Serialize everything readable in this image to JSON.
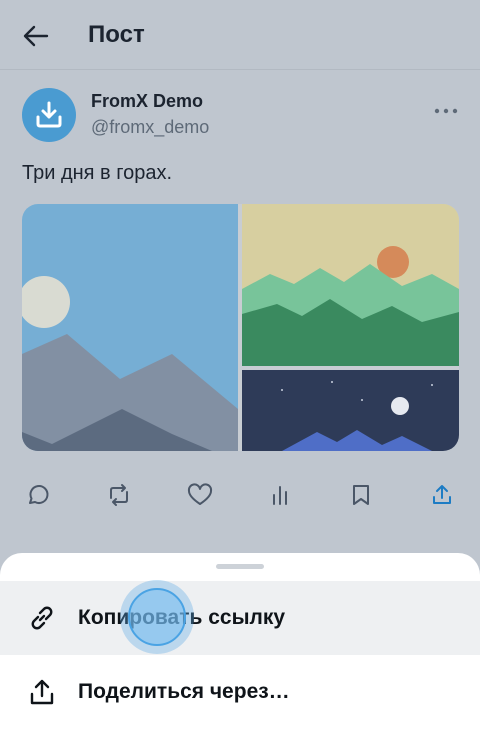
{
  "header": {
    "title": "Пост",
    "back_icon": "arrow-left-icon"
  },
  "post": {
    "author_name": "FromX Demo",
    "author_handle": "@fromx_demo",
    "avatar_icon": "download-icon",
    "text": "Три дня в горах.",
    "media": [
      {
        "name": "mountain-day-photo",
        "palette": [
          "#76aed4",
          "#d9dbd2",
          "#8290a3",
          "#5c6b80"
        ]
      },
      {
        "name": "mountain-sunset-photo",
        "palette": [
          "#d7cfa0",
          "#d58a5a",
          "#78c49a",
          "#3a8a5f"
        ]
      },
      {
        "name": "mountain-night-photo",
        "palette": [
          "#2e3b58",
          "#e6e9f0",
          "#4f6ec7"
        ]
      }
    ]
  },
  "actions": [
    {
      "name": "reply-button",
      "icon": "comment-icon"
    },
    {
      "name": "repost-button",
      "icon": "repost-icon"
    },
    {
      "name": "like-button",
      "icon": "heart-icon"
    },
    {
      "name": "views-button",
      "icon": "bar-chart-icon"
    },
    {
      "name": "bookmark-button",
      "icon": "bookmark-icon"
    },
    {
      "name": "share-button",
      "icon": "share-icon",
      "color": "#1d7cc4"
    }
  ],
  "share_sheet": {
    "items": [
      {
        "label": "Копировать ссылку",
        "icon": "link-icon"
      },
      {
        "label": "Поделиться через…",
        "icon": "share-icon"
      }
    ]
  }
}
